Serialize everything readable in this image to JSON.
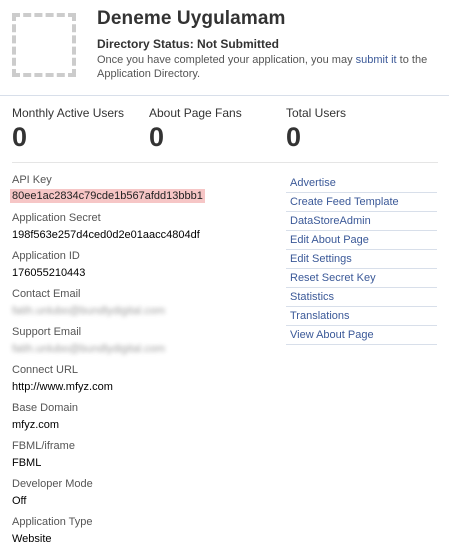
{
  "header": {
    "app_name": "Deneme Uygulamam",
    "directory_status": "Directory Status: Not Submitted",
    "desc_before": "Once you have completed your application, you may ",
    "submit_link": "submit it",
    "desc_after": " to the Application Directory."
  },
  "stats": [
    {
      "label": "Monthly Active Users",
      "value": "0"
    },
    {
      "label": "About Page Fans",
      "value": "0"
    },
    {
      "label": "Total Users",
      "value": "0"
    }
  ],
  "fields": {
    "api_key": {
      "label": "API Key",
      "value": "80ee1ac2834c79cde1b567afdd13bbb1"
    },
    "app_secret": {
      "label": "Application Secret",
      "value": "198f563e257d4ced0d2e01aacc4804df"
    },
    "app_id": {
      "label": "Application ID",
      "value": "176055210443"
    },
    "contact_email": {
      "label": "Contact Email",
      "value": "fatih.unlubo@bundlydigital.com"
    },
    "support_email": {
      "label": "Support Email",
      "value": "fatih.unlubo@bundlydigital.com"
    },
    "connect_url": {
      "label": "Connect URL",
      "value": "http://www.mfyz.com"
    },
    "base_domain": {
      "label": "Base Domain",
      "value": "mfyz.com"
    },
    "fbml_iframe": {
      "label": "FBML/iframe",
      "value": "FBML"
    },
    "developer_mode": {
      "label": "Developer Mode",
      "value": "Off"
    },
    "app_type": {
      "label": "Application Type",
      "value": "Website"
    }
  },
  "links": [
    "Advertise",
    "Create Feed Template",
    "DataStoreAdmin",
    "Edit About Page",
    "Edit Settings",
    "Reset Secret Key",
    "Statistics",
    "Translations",
    "View About Page"
  ],
  "colors": {
    "link": "#3b5998",
    "highlight": "#f6c6c6",
    "divider": "#d8dfea"
  }
}
